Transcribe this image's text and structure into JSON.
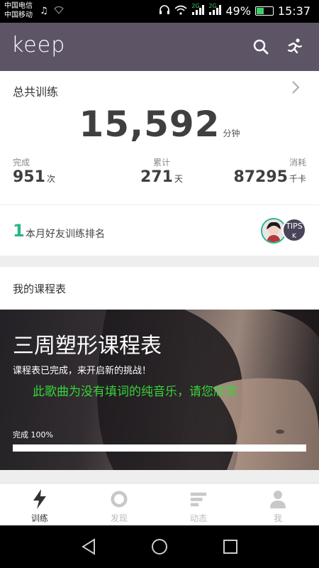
{
  "status_bar": {
    "carrier1": "中国电信",
    "carrier2": "中国移动",
    "battery": "49%",
    "battery_level": 0.49,
    "time": "15:37",
    "net1": "2G",
    "net2": "2G"
  },
  "app_bar": {
    "logo": "keep",
    "search_icon": "search-icon",
    "run_icon": "running-icon"
  },
  "total": {
    "label": "总共训练",
    "value": "15,592",
    "unit": "分钟",
    "stats": [
      {
        "label": "完成",
        "value": "951",
        "unit": "次"
      },
      {
        "label": "累计",
        "value": "271",
        "unit": "天"
      },
      {
        "label": "消耗",
        "value": "87295",
        "unit": "千卡"
      }
    ]
  },
  "rank": {
    "number": "1",
    "label": "本月好友训练排名",
    "badge": "TIPS",
    "badge_sub": "K"
  },
  "course": {
    "header": "我的课程表",
    "title": "三周塑形课程表",
    "subtitle": "课程表已完成，来开启新的挑战！",
    "overlay": "此歌曲为没有填词的纯音乐，请您欣赏",
    "progress_label": "完成 100%",
    "progress": 1.0
  },
  "tabs": [
    {
      "label": "训练",
      "icon": "lightning-icon",
      "active": true
    },
    {
      "label": "发现",
      "icon": "discover-ring-icon",
      "active": false
    },
    {
      "label": "动态",
      "icon": "feed-lines-icon",
      "active": false
    },
    {
      "label": "我",
      "icon": "person-icon",
      "active": false
    }
  ],
  "colors": {
    "app_bar": "#5d5466",
    "accent_green": "#27b78b",
    "overlay_green": "#37d43a"
  }
}
